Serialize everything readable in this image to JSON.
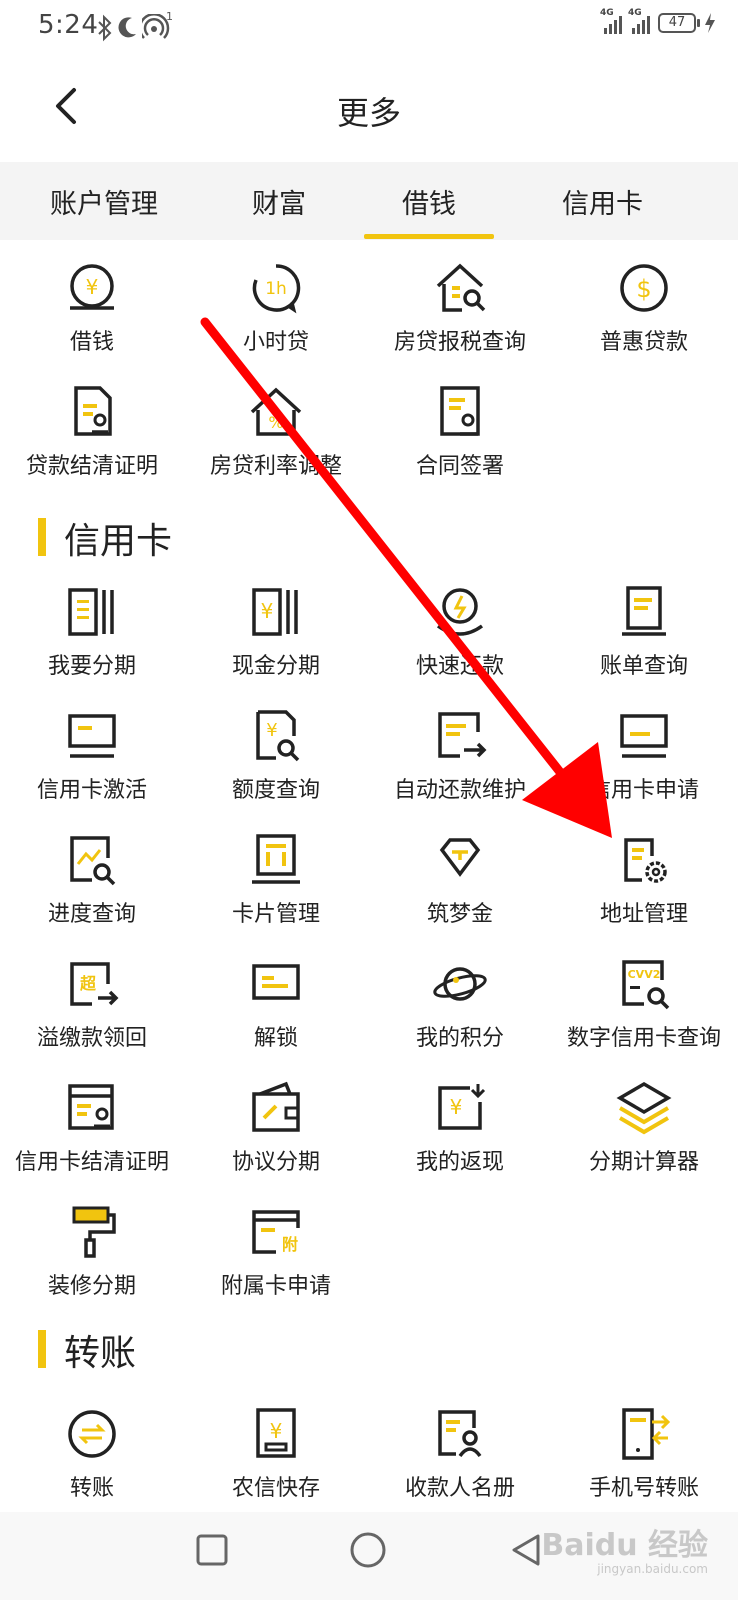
{
  "status": {
    "time": "5:24",
    "signal1": "4G",
    "signal2": "4G",
    "hotspot_count": "1",
    "battery": "47"
  },
  "header": {
    "title": "更多"
  },
  "tabs": [
    {
      "label": "账户管理"
    },
    {
      "label": "财富"
    },
    {
      "label": "借钱"
    },
    {
      "label": "信用卡"
    }
  ],
  "active_tab": "借钱",
  "loan": {
    "items": [
      {
        "label": "借钱",
        "icon": "yen-coin-icon"
      },
      {
        "label": "小时贷",
        "icon": "one-hour-clock-icon"
      },
      {
        "label": "房贷报税查询",
        "icon": "house-search-icon"
      },
      {
        "label": "普惠贷款",
        "icon": "dollar-coin-icon"
      },
      {
        "label": "贷款结清证明",
        "icon": "certificate-stamp-icon"
      },
      {
        "label": "房贷利率调整",
        "icon": "house-rate-icon"
      },
      {
        "label": "合同签署",
        "icon": "contract-sign-icon"
      }
    ]
  },
  "credit": {
    "title": "信用卡",
    "items": [
      {
        "label": "我要分期",
        "icon": "installment-icon"
      },
      {
        "label": "现金分期",
        "icon": "cash-installment-icon"
      },
      {
        "label": "快速还款",
        "icon": "quick-repay-icon"
      },
      {
        "label": "账单查询",
        "icon": "bill-query-icon"
      },
      {
        "label": "信用卡激活",
        "icon": "card-activate-icon"
      },
      {
        "label": "额度查询",
        "icon": "limit-query-icon"
      },
      {
        "label": "自动还款维护",
        "icon": "auto-repay-icon"
      },
      {
        "label": "信用卡申请",
        "icon": "card-apply-icon"
      },
      {
        "label": "进度查询",
        "icon": "progress-query-icon"
      },
      {
        "label": "卡片管理",
        "icon": "card-manage-icon"
      },
      {
        "label": "筑梦金",
        "icon": "diamond-icon"
      },
      {
        "label": "地址管理",
        "icon": "address-settings-icon"
      },
      {
        "label": "溢缴款领回",
        "icon": "overpay-refund-icon"
      },
      {
        "label": "解锁",
        "icon": "unlock-card-icon"
      },
      {
        "label": "我的积分",
        "icon": "planet-points-icon"
      },
      {
        "label": "数字信用卡查询",
        "icon": "cvv2-search-icon"
      },
      {
        "label": "信用卡结清证明",
        "icon": "card-certificate-icon"
      },
      {
        "label": "协议分期",
        "icon": "wallet-agreement-icon"
      },
      {
        "label": "我的返现",
        "icon": "cashback-icon"
      },
      {
        "label": "分期计算器",
        "icon": "layers-icon"
      },
      {
        "label": "装修分期",
        "icon": "paint-roller-icon"
      },
      {
        "label": "附属卡申请",
        "icon": "supplementary-card-icon"
      }
    ]
  },
  "transfer": {
    "title": "转账",
    "items": [
      {
        "label": "转账",
        "icon": "transfer-icon"
      },
      {
        "label": "农信快存",
        "icon": "quick-deposit-icon"
      },
      {
        "label": "收款人名册",
        "icon": "payee-list-icon"
      },
      {
        "label": "手机号转账",
        "icon": "phone-transfer-icon"
      }
    ]
  },
  "watermark": {
    "brand": "Baidu 经验",
    "url": "jingyan.baidu.com"
  },
  "colors": {
    "accent": "#f1c40f",
    "annotation": "#ff0000",
    "text": "#222222"
  }
}
